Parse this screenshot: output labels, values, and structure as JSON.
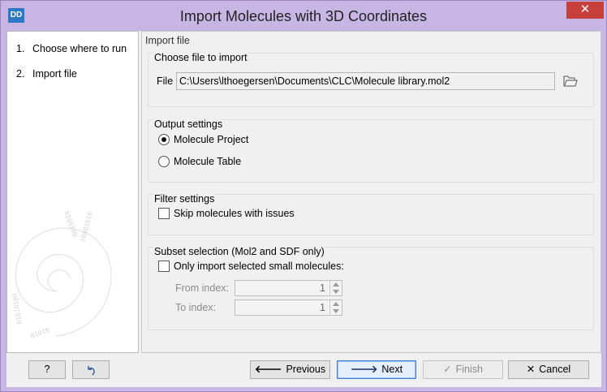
{
  "window": {
    "title": "Import Molecules with 3D Coordinates",
    "app_badge": "DD",
    "close_glyph": "✕"
  },
  "steps": [
    {
      "number": "1.",
      "label": "Choose where to run"
    },
    {
      "number": "2.",
      "label": "Import file"
    }
  ],
  "section_label": "Import file",
  "choose_file": {
    "group_title": "Choose file to import",
    "file_label": "File",
    "file_value": "C:\\Users\\lthoegersen\\Documents\\CLC\\Molecule library.mol2"
  },
  "output_settings": {
    "group_title": "Output settings",
    "options": [
      {
        "label": "Molecule Project",
        "selected": true
      },
      {
        "label": "Molecule Table",
        "selected": false
      }
    ]
  },
  "filter_settings": {
    "group_title": "Filter settings",
    "skip_label": "Skip molecules with issues",
    "skip_checked": false
  },
  "subset_selection": {
    "group_title": "Subset selection (Mol2 and SDF only)",
    "only_import_label": "Only import selected small molecules:",
    "only_import_checked": false,
    "from_label": "From index:",
    "from_value": "1",
    "to_label": "To index:",
    "to_value": "1"
  },
  "buttons": {
    "help": "?",
    "reset_icon": "reset-arrow-icon",
    "previous": "Previous",
    "next": "Next",
    "finish": "Finish",
    "cancel": "Cancel"
  },
  "colors": {
    "title_bar": "#c7b6e4",
    "close_button": "#c7403b",
    "app_badge": "#2a78c6",
    "primary_button_border": "#3c7fd5"
  }
}
